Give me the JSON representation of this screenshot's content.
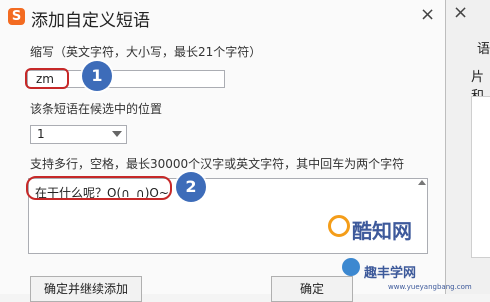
{
  "dialog": {
    "logo_glyph": "S",
    "title": "添加自定义短语",
    "close_glyph": "×"
  },
  "abbr": {
    "label": "缩写（英文字符，大小写，最长21个字符）",
    "value": "zm"
  },
  "position": {
    "label": "该条短语在候选中的位置",
    "value": "1"
  },
  "phrase": {
    "label": "支持多行，空格，最长30000个汉字或英文字符，其中回车为两个字符",
    "value": "在干什么呢？O(∩_∩)O~"
  },
  "badges": [
    "1",
    "2"
  ],
  "buttons": {
    "continue": "确定并继续添加",
    "ok": "确定"
  },
  "background_window": {
    "close_glyph": "×",
    "text1": "语",
    "text2": "片和"
  },
  "watermarks": {
    "brand1": "酷知网",
    "brand2": "趣丰学网",
    "url": "www.yueyangbang.com"
  },
  "colors": {
    "highlight_red": "#c62828",
    "badge_blue": "#3d6cb9",
    "logo_orange": "#f36b21"
  }
}
